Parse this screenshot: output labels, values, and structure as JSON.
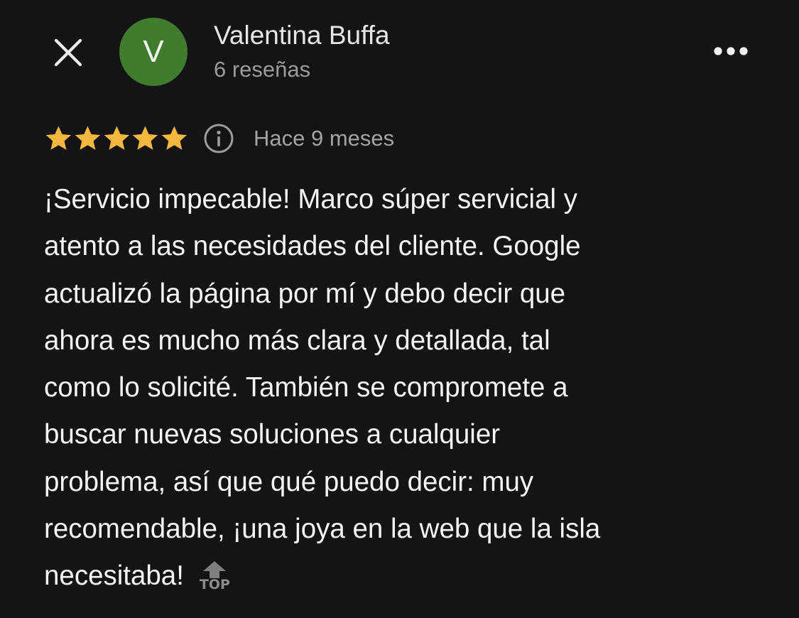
{
  "header": {
    "close_icon": "close-icon",
    "avatar_letter": "V",
    "avatar_color": "#3f7c2d",
    "user_name": "Valentina Buffa",
    "review_count": "6 reseñas",
    "more_icon": "more-horizontal-icon"
  },
  "review": {
    "rating": 5,
    "rating_max": 5,
    "star_color": "#f4b83f",
    "info_icon": "info-icon",
    "date": "Hace 9 meses",
    "text_lines": [
      "¡Servicio impecable! Marco súper servicial y",
      "atento a las necesidades del cliente. Google",
      "actualizó la página por mí y debo decir que",
      "ahora es mucho más clara y detallada, tal",
      "como lo solicité. También se compromete a",
      "buscar nuevas soluciones a cualquier",
      "problema, así que qué puedo decir: muy",
      "recomendable, ¡una joya en la web que la isla",
      "necesitaba!"
    ]
  },
  "scroll_top": {
    "label": "TOP",
    "icon": "arrow-up-icon"
  },
  "theme": {
    "background": "#141316",
    "text_primary": "#f4f4f4",
    "text_secondary": "#9b9b9f"
  }
}
